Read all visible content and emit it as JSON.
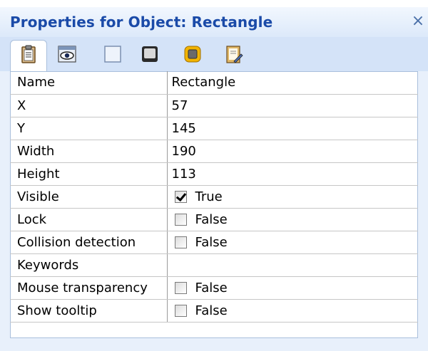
{
  "window": {
    "title": "Properties for Object: Rectangle",
    "close_glyph": "×"
  },
  "toolbar": {
    "tabs": [
      {
        "icon": "clipboard-icon",
        "active": true
      },
      {
        "icon": "eye-icon"
      },
      {
        "icon": "blank-square-icon"
      },
      {
        "icon": "dark-square-icon"
      },
      {
        "icon": "gold-square-icon"
      },
      {
        "icon": "document-edit-icon"
      }
    ]
  },
  "properties": [
    {
      "name": "Name",
      "value": "Rectangle"
    },
    {
      "name": "X",
      "value": "57"
    },
    {
      "name": "Y",
      "value": "145"
    },
    {
      "name": "Width",
      "value": "190"
    },
    {
      "name": "Height",
      "value": "113"
    },
    {
      "name": "Visible",
      "value": "True",
      "checkbox": true,
      "checked": true
    },
    {
      "name": "Lock",
      "value": "False",
      "checkbox": true,
      "checked": false
    },
    {
      "name": "Collision detection",
      "value": "False",
      "checkbox": true,
      "checked": false
    },
    {
      "name": "Keywords",
      "value": ""
    },
    {
      "name": "Mouse transparency",
      "value": "False",
      "checkbox": true,
      "checked": false
    },
    {
      "name": "Show tooltip",
      "value": "False",
      "checkbox": true,
      "checked": false
    }
  ],
  "colors": {
    "title_text": "#1a4aa8",
    "toolbar_bg": "#d4e3f8",
    "panel_bg": "#e8f0fb"
  }
}
